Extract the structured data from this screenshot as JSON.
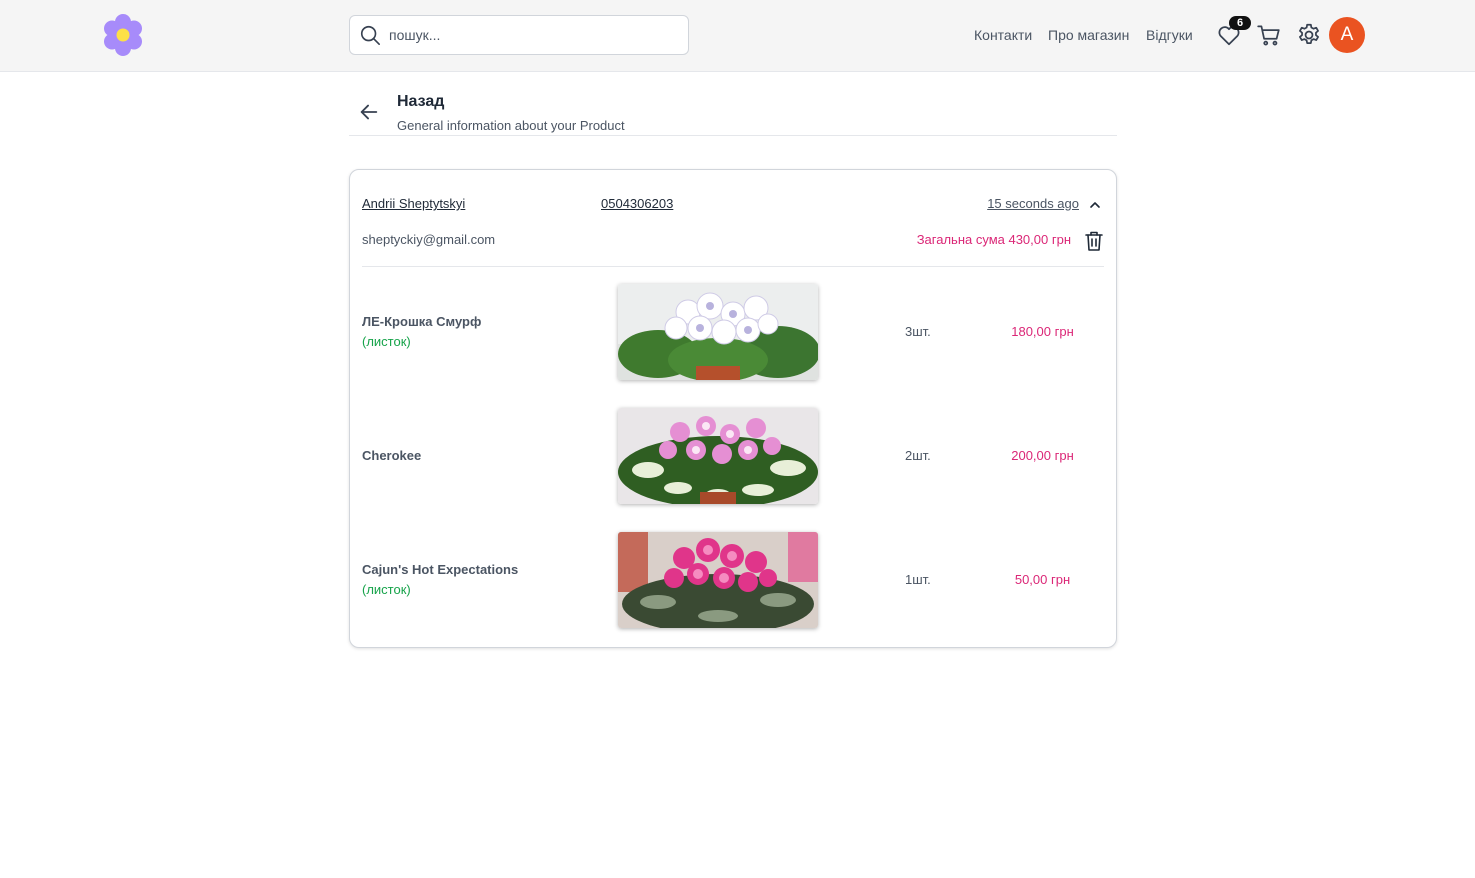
{
  "header": {
    "search_placeholder": "пошук...",
    "nav": [
      "Контакти",
      "Про магазин",
      "Відгуки"
    ],
    "wishlist_count": "6",
    "avatar_letter": "A"
  },
  "page": {
    "title": "Назад",
    "subtitle": "General information about your Product"
  },
  "order": {
    "customer_name": "Andrii Sheptytskyi",
    "phone": "0504306203",
    "time": "15 seconds ago",
    "email": "sheptyckiy@gmail.com",
    "total": "Загальна сума 430,00 грн",
    "items": [
      {
        "name": "ЛЕ-Крошка Смурф",
        "variant": "(листок)",
        "qty": "3шт.",
        "price": "180,00 грн"
      },
      {
        "name": "Cherokee",
        "variant": "",
        "qty": "2шт.",
        "price": "200,00 грн"
      },
      {
        "name": "Cajun's Hot Expectations",
        "variant": "(листок)",
        "qty": "1шт.",
        "price": "50,00 грн"
      }
    ]
  },
  "colors": {
    "accent_pink": "#db2777",
    "variant_green": "#16a34a",
    "avatar_orange": "#ea5321",
    "logo_petal": "#a78bfa",
    "logo_center": "#fde047"
  },
  "icons": [
    "flower-logo-icon",
    "search-icon",
    "heart-icon",
    "cart-icon",
    "gear-icon",
    "arrow-left-icon",
    "chevron-up-icon",
    "trash-icon"
  ]
}
